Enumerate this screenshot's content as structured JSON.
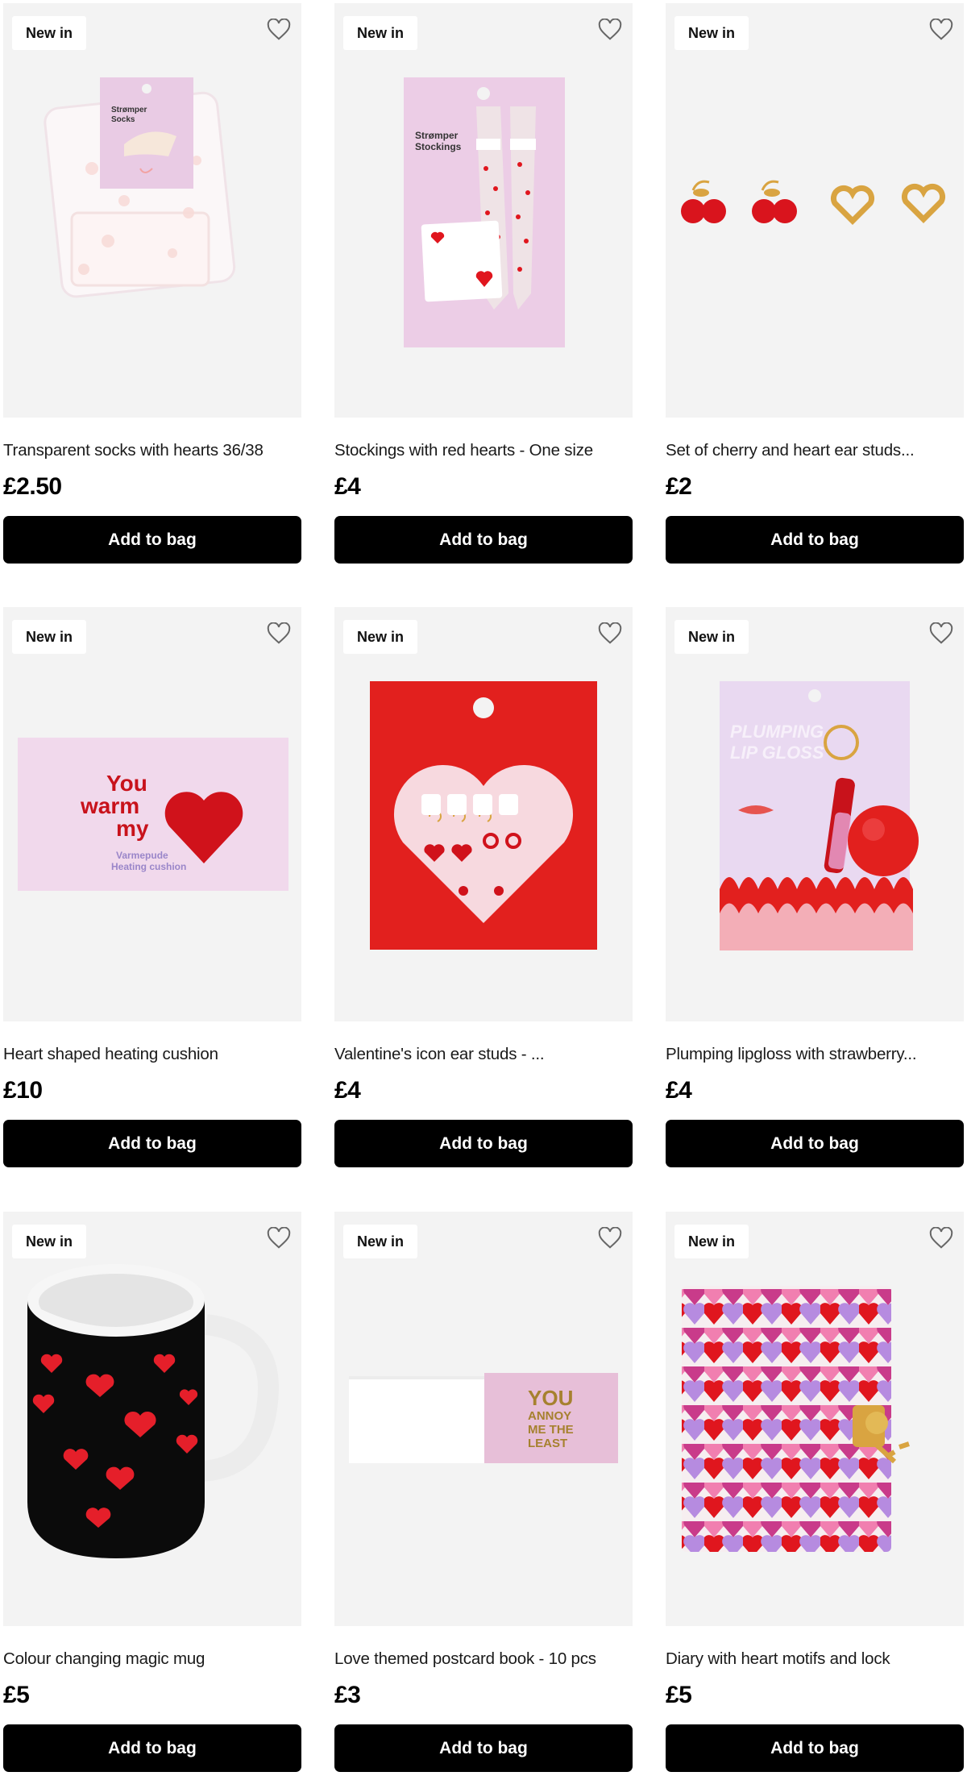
{
  "products": [
    {
      "badge": "New in",
      "title": "Transparent socks with hearts 36/38",
      "price": "£2.50",
      "cta": "Add to bag",
      "image": "socks-image",
      "pack_title": "Strømper Socks"
    },
    {
      "badge": "New in",
      "title": "Stockings with red hearts - One size",
      "price": "£4",
      "cta": "Add to bag",
      "image": "stockings-image",
      "pack_title": "Strømper Stockings"
    },
    {
      "badge": "New in",
      "title": "Set of cherry and heart ear studs...",
      "price": "£2",
      "cta": "Add to bag",
      "image": "ear-studs-image"
    },
    {
      "badge": "New in",
      "title": "Heart shaped heating cushion",
      "price": "£10",
      "cta": "Add to bag",
      "image": "heating-cushion-image",
      "pack_line1": "You",
      "pack_line2": "warm",
      "pack_line3": "my",
      "pack_sub1": "Varmepude",
      "pack_sub2": "Heating cushion"
    },
    {
      "badge": "New in",
      "title": "Valentine's icon ear studs - ...",
      "price": "£4",
      "cta": "Add to bag",
      "image": "icon-ear-studs-image"
    },
    {
      "badge": "New in",
      "title": "Plumping lipgloss with strawberry...",
      "price": "£4",
      "cta": "Add to bag",
      "image": "lipgloss-image",
      "pack_line1": "PLUMPING",
      "pack_line2": "LIP GLOSS"
    },
    {
      "badge": "New in",
      "title": "Colour changing magic mug",
      "price": "£5",
      "cta": "Add to bag",
      "image": "mug-image"
    },
    {
      "badge": "New in",
      "title": "Love themed postcard book - 10 pcs",
      "price": "£3",
      "cta": "Add to bag",
      "image": "postcard-book-image",
      "cover_line1": "YOU",
      "cover_line2": "ANNOY",
      "cover_line3": "ME THE",
      "cover_line4": "LEAST"
    },
    {
      "badge": "New in",
      "title": "Diary with heart motifs and lock",
      "price": "£5",
      "cta": "Add to bag",
      "image": "diary-image"
    }
  ],
  "colors": {
    "accent": "#000000",
    "heart_red": "#e0161e",
    "pink_pack": "#f1d9ec",
    "tile_bg": "#f3f3f3"
  },
  "icons": {
    "wishlist": "heart-outline-icon"
  }
}
